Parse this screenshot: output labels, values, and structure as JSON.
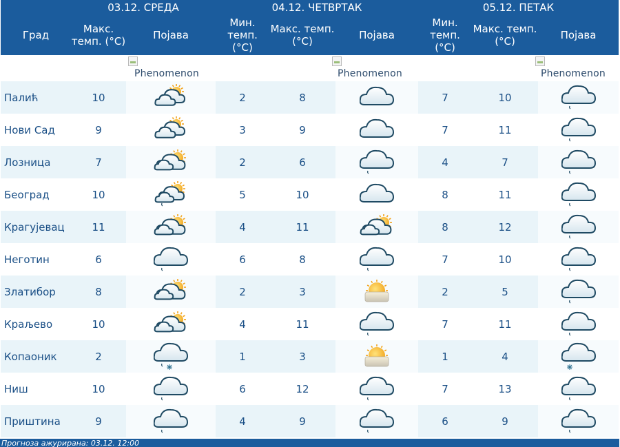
{
  "days": [
    {
      "label": "03.12. СРЕДА"
    },
    {
      "label": "04.12. ЧЕТВРТАК"
    },
    {
      "label": "05.12. ПЕТАК"
    }
  ],
  "columns": {
    "city": "Град",
    "max": "Макс. темп. (°C)",
    "min": "Мин. темп. (°C)",
    "phenomenon": "Појава"
  },
  "phenomenon_alt": "Phenomenon",
  "rows": [
    {
      "city": "Палић",
      "d1_max": "10",
      "d1_icon": "partly-cloudy-sun-icon",
      "d2_min": "2",
      "d2_max": "8",
      "d2_icon": "cloud-icon",
      "d3_min": "7",
      "d3_max": "10",
      "d3_icon": "cloud-drizzle-icon"
    },
    {
      "city": "Нови Сад",
      "d1_max": "9",
      "d1_icon": "partly-cloudy-sun-icon",
      "d2_min": "3",
      "d2_max": "9",
      "d2_icon": "cloud-icon",
      "d3_min": "7",
      "d3_max": "11",
      "d3_icon": "cloud-drizzle-icon"
    },
    {
      "city": "Лозница",
      "d1_max": "7",
      "d1_icon": "cloudy-sun-icon",
      "d2_min": "2",
      "d2_max": "6",
      "d2_icon": "cloud-drizzle-icon",
      "d3_min": "4",
      "d3_max": "7",
      "d3_icon": "cloud-drizzle-icon"
    },
    {
      "city": "Београд",
      "d1_max": "10",
      "d1_icon": "partly-cloudy-drizzle-icon",
      "d2_min": "5",
      "d2_max": "10",
      "d2_icon": "cloud-icon",
      "d3_min": "8",
      "d3_max": "11",
      "d3_icon": "cloud-drizzle-icon"
    },
    {
      "city": "Крагујевац",
      "d1_max": "11",
      "d1_icon": "cloudy-sun-icon",
      "d2_min": "4",
      "d2_max": "11",
      "d2_icon": "cloudy-sun-icon",
      "d3_min": "8",
      "d3_max": "12",
      "d3_icon": "cloud-drizzle-icon"
    },
    {
      "city": "Неготин",
      "d1_max": "6",
      "d1_icon": "cloud-drizzle-icon",
      "d2_min": "6",
      "d2_max": "8",
      "d2_icon": "cloud-drizzle-icon",
      "d3_min": "7",
      "d3_max": "10",
      "d3_icon": "cloud-drizzle-icon"
    },
    {
      "city": "Златибор",
      "d1_max": "8",
      "d1_icon": "cloudy-sun-icon",
      "d2_min": "2",
      "d2_max": "3",
      "d2_icon": "fog-sun-icon",
      "d3_min": "2",
      "d3_max": "5",
      "d3_icon": "cloud-drizzle-icon"
    },
    {
      "city": "Краљево",
      "d1_max": "10",
      "d1_icon": "cloudy-sun-icon",
      "d2_min": "4",
      "d2_max": "11",
      "d2_icon": "cloud-drizzle-icon",
      "d3_min": "7",
      "d3_max": "11",
      "d3_icon": "cloud-drizzle-icon"
    },
    {
      "city": "Копаоник",
      "d1_max": "2",
      "d1_icon": "cloud-rain-snow-icon",
      "d2_min": "1",
      "d2_max": "3",
      "d2_icon": "fog-sun-icon",
      "d3_min": "1",
      "d3_max": "4",
      "d3_icon": "cloud-snow-icon"
    },
    {
      "city": "Ниш",
      "d1_max": "10",
      "d1_icon": "cloud-drizzle-icon",
      "d2_min": "6",
      "d2_max": "12",
      "d2_icon": "cloud-drizzle-icon",
      "d3_min": "7",
      "d3_max": "13",
      "d3_icon": "cloud-drizzle-icon"
    },
    {
      "city": "Приштина",
      "d1_max": "9",
      "d1_icon": "cloud-drizzle-icon",
      "d2_min": "4",
      "d2_max": "9",
      "d2_icon": "cloud-drizzle-icon",
      "d3_min": "6",
      "d3_max": "9",
      "d3_icon": "cloud-drizzle-icon"
    }
  ],
  "footer": "Прогноза ажурирана:  03.12. 12:00",
  "colors": {
    "header": "#1b5c9d",
    "row_alt": "#e9f4f9",
    "text": "#1a4f86"
  }
}
